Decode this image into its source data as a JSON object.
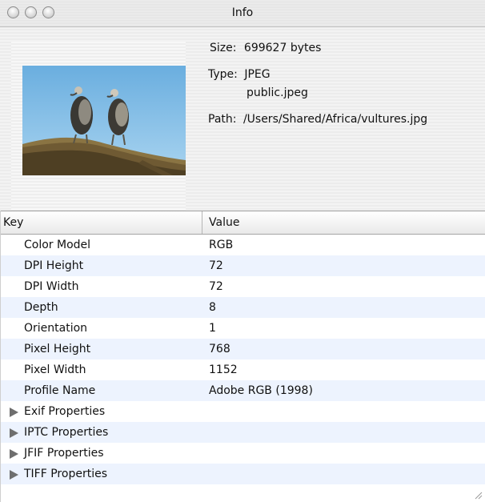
{
  "window": {
    "title": "Info"
  },
  "file_info": {
    "size_label": "Size:",
    "size_value": "699627 bytes",
    "type_label": "Type:",
    "type_value": "JPEG",
    "type_uti": "public.jpeg",
    "path_label": "Path:",
    "path_value": "/Users/Shared/Africa/vultures.jpg"
  },
  "table": {
    "headers": {
      "key": "Key",
      "value": "Value"
    },
    "rows": [
      {
        "key": "Color Model",
        "value": "RGB"
      },
      {
        "key": "DPI Height",
        "value": "72"
      },
      {
        "key": "DPI Width",
        "value": "72"
      },
      {
        "key": "Depth",
        "value": "8"
      },
      {
        "key": "Orientation",
        "value": "1"
      },
      {
        "key": "Pixel Height",
        "value": "768"
      },
      {
        "key": "Pixel Width",
        "value": "1152"
      },
      {
        "key": "Profile Name",
        "value": "Adobe RGB (1998)"
      }
    ],
    "groups": [
      {
        "label": "Exif Properties"
      },
      {
        "label": "IPTC Properties"
      },
      {
        "label": "JFIF Properties"
      },
      {
        "label": "TIFF Properties"
      }
    ]
  }
}
